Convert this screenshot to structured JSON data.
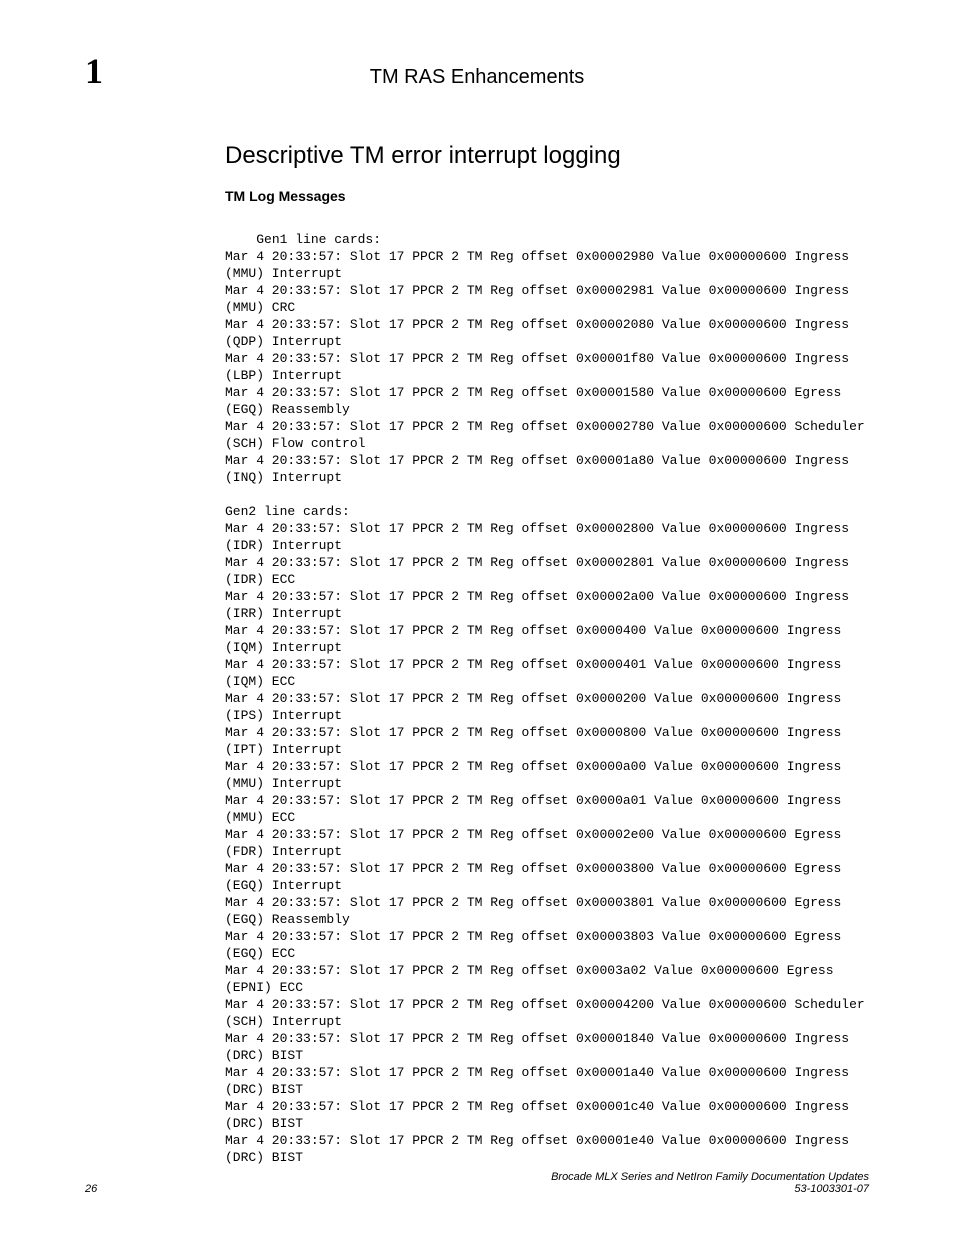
{
  "header": {
    "chapter_number": "1",
    "running_title": "TM RAS Enhancements"
  },
  "section": {
    "title": "Descriptive TM error interrupt logging",
    "subtitle": "TM Log Messages"
  },
  "logs": {
    "gen1_heading": "Gen1 line cards:",
    "gen1_lines": [
      "Mar 4 20:33:57: Slot 17 PPCR 2 TM Reg offset 0x00002980 Value 0x00000600 Ingress (MMU) Interrupt",
      "Mar 4 20:33:57: Slot 17 PPCR 2 TM Reg offset 0x00002981 Value 0x00000600 Ingress (MMU) CRC",
      "Mar 4 20:33:57: Slot 17 PPCR 2 TM Reg offset 0x00002080 Value 0x00000600 Ingress (QDP) Interrupt",
      "Mar 4 20:33:57: Slot 17 PPCR 2 TM Reg offset 0x00001f80 Value 0x00000600 Ingress (LBP) Interrupt",
      "Mar 4 20:33:57: Slot 17 PPCR 2 TM Reg offset 0x00001580 Value 0x00000600 Egress (EGQ) Reassembly",
      "Mar 4 20:33:57: Slot 17 PPCR 2 TM Reg offset 0x00002780 Value 0x00000600 Scheduler (SCH) Flow control",
      "Mar 4 20:33:57: Slot 17 PPCR 2 TM Reg offset 0x00001a80 Value 0x00000600 Ingress (INQ) Interrupt"
    ],
    "gen2_heading": "Gen2 line cards:",
    "gen2_lines": [
      "Mar 4 20:33:57: Slot 17 PPCR 2 TM Reg offset 0x00002800 Value 0x00000600 Ingress (IDR) Interrupt",
      "Mar 4 20:33:57: Slot 17 PPCR 2 TM Reg offset 0x00002801 Value 0x00000600 Ingress (IDR) ECC",
      "Mar 4 20:33:57: Slot 17 PPCR 2 TM Reg offset 0x00002a00 Value 0x00000600 Ingress (IRR) Interrupt",
      "Mar 4 20:33:57: Slot 17 PPCR 2 TM Reg offset 0x0000400 Value 0x00000600 Ingress (IQM) Interrupt",
      "Mar 4 20:33:57: Slot 17 PPCR 2 TM Reg offset 0x0000401 Value 0x00000600 Ingress (IQM) ECC",
      "Mar 4 20:33:57: Slot 17 PPCR 2 TM Reg offset 0x0000200 Value 0x00000600 Ingress (IPS) Interrupt",
      "Mar 4 20:33:57: Slot 17 PPCR 2 TM Reg offset 0x0000800 Value 0x00000600 Ingress (IPT) Interrupt",
      "Mar 4 20:33:57: Slot 17 PPCR 2 TM Reg offset 0x0000a00 Value 0x00000600 Ingress (MMU) Interrupt",
      "Mar 4 20:33:57: Slot 17 PPCR 2 TM Reg offset 0x0000a01 Value 0x00000600 Ingress (MMU) ECC",
      "Mar 4 20:33:57: Slot 17 PPCR 2 TM Reg offset 0x00002e00 Value 0x00000600 Egress (FDR) Interrupt",
      "Mar 4 20:33:57: Slot 17 PPCR 2 TM Reg offset 0x00003800 Value 0x00000600 Egress (EGQ) Interrupt",
      "Mar 4 20:33:57: Slot 17 PPCR 2 TM Reg offset 0x00003801 Value 0x00000600 Egress (EGQ) Reassembly",
      "Mar 4 20:33:57: Slot 17 PPCR 2 TM Reg offset 0x00003803 Value 0x00000600 Egress (EGQ) ECC",
      "Mar 4 20:33:57: Slot 17 PPCR 2 TM Reg offset 0x0003a02 Value 0x00000600 Egress (EPNI) ECC",
      "Mar 4 20:33:57: Slot 17 PPCR 2 TM Reg offset 0x00004200 Value 0x00000600 Scheduler (SCH) Interrupt",
      "Mar 4 20:33:57: Slot 17 PPCR 2 TM Reg offset 0x00001840 Value 0x00000600 Ingress (DRC) BIST",
      "Mar 4 20:33:57: Slot 17 PPCR 2 TM Reg offset 0x00001a40 Value 0x00000600 Ingress (DRC) BIST",
      "Mar 4 20:33:57: Slot 17 PPCR 2 TM Reg offset 0x00001c40 Value 0x00000600 Ingress (DRC) BIST",
      "Mar 4 20:33:57: Slot 17 PPCR 2 TM Reg offset 0x00001e40 Value 0x00000600 Ingress (DRC) BIST"
    ]
  },
  "footer": {
    "page_number": "26",
    "doc_title": "Brocade MLX Series and NetIron Family Documentation Updates",
    "doc_id": "53-1003301-07"
  }
}
